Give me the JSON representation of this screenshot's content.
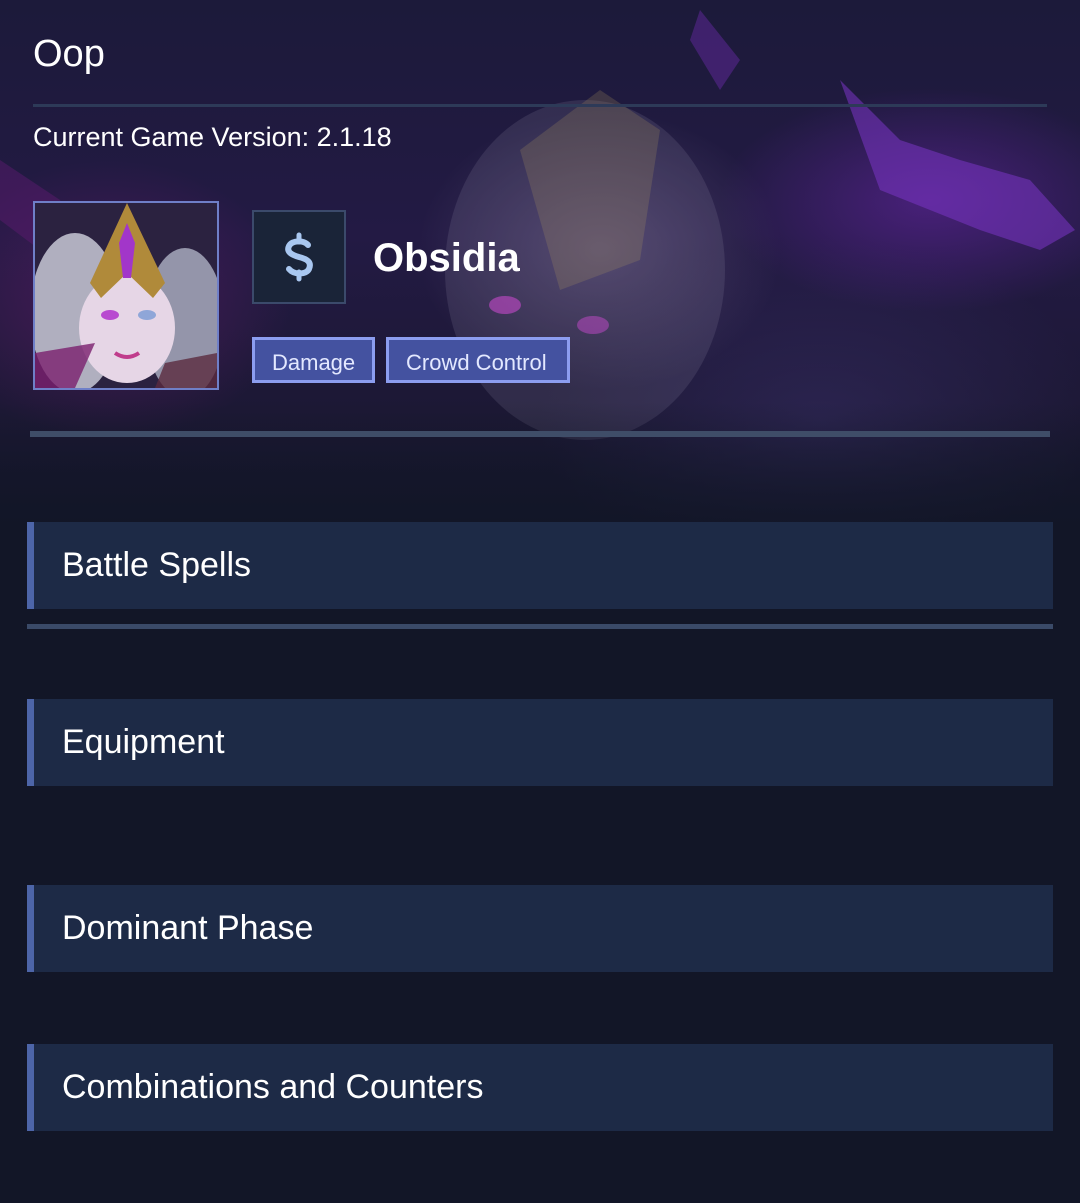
{
  "header": {
    "title": "Oop",
    "version_text": "Current Game Version: 2.1.18"
  },
  "champion": {
    "name": "Obsidia",
    "portrait_alt": "Obsidia portrait",
    "role_icon": "dollar-sign-icon",
    "tags": [
      "Damage",
      "Crowd Control"
    ]
  },
  "sections": [
    {
      "label": "Battle Spells"
    },
    {
      "label": "Equipment"
    },
    {
      "label": "Dominant Phase"
    },
    {
      "label": "Combinations and Counters"
    }
  ],
  "colors": {
    "background": "#121627",
    "section_bg": "#1d2a46",
    "section_accent": "#4d65a8",
    "tag_bg": "#4452a0",
    "tag_border": "#8c9df0"
  }
}
